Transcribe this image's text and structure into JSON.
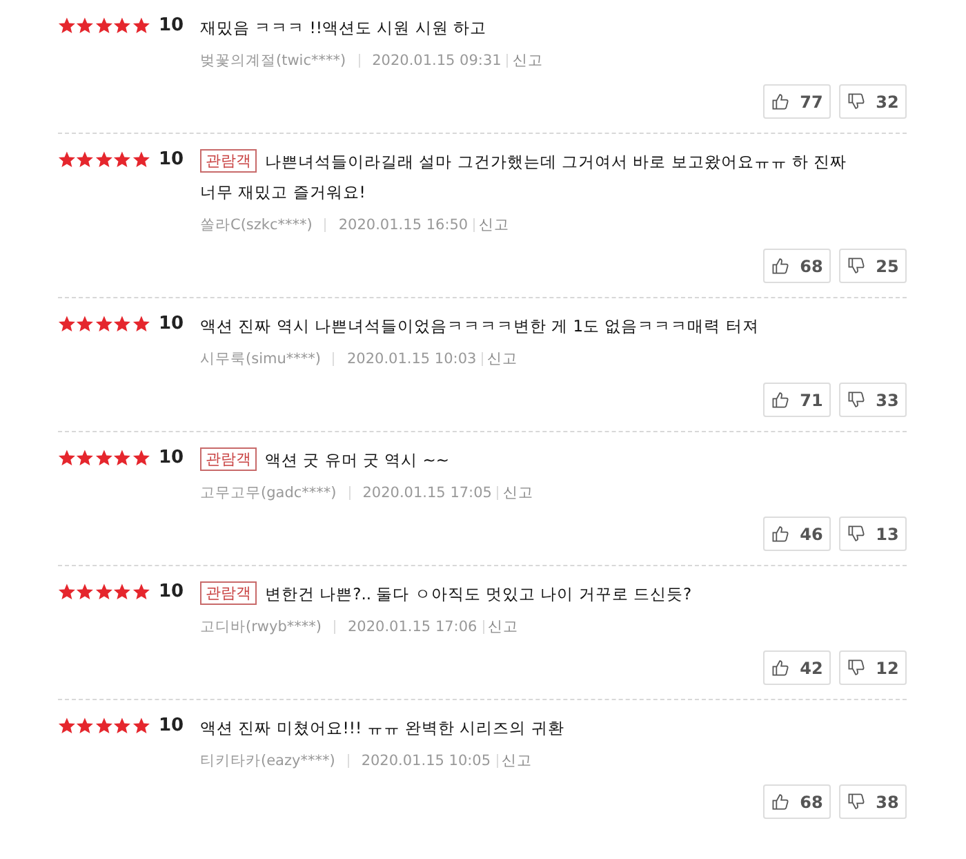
{
  "reviews": [
    {
      "stars": 5,
      "score": "10",
      "text": "재밌음 ㅋㅋㅋ !!액션도 시원 시원 하고",
      "author": "벚꽃의계절(twic****)",
      "date": "2020.01.15 09:31",
      "report": "신고",
      "likes": "77",
      "dislikes": "32"
    },
    {
      "stars": 5,
      "score": "10",
      "badge": "관람객",
      "text": "나쁜녀석들이라길래 설마 그건가했는데 그거여서 바로 보고왔어요ㅠㅠ 하 진짜 너무 재밌고 즐거워요!",
      "author": "쏠라C(szkc****)",
      "date": "2020.01.15 16:50",
      "report": "신고",
      "likes": "68",
      "dislikes": "25"
    },
    {
      "stars": 5,
      "score": "10",
      "text": "액션 진짜 역시 나쁜녀석들이었음ㅋㅋㅋㅋ변한 게 1도 없음ㅋㅋㅋ매력 터져",
      "author": "시무룩(simu****)",
      "date": "2020.01.15 10:03",
      "report": "신고",
      "likes": "71",
      "dislikes": "33"
    },
    {
      "stars": 5,
      "score": "10",
      "badge": "관람객",
      "text": "액션 굿 유머 굿 역시 ~~",
      "author": "고무고무(gadc****)",
      "date": "2020.01.15 17:05",
      "report": "신고",
      "likes": "46",
      "dislikes": "13"
    },
    {
      "stars": 5,
      "score": "10",
      "badge": "관람객",
      "text": "변한건 나쁜?.. 둘다 ㅇ아직도 멋있고 나이 거꾸로 드신듯?",
      "author": "고디바(rwyb****)",
      "date": "2020.01.15 17:06",
      "report": "신고",
      "likes": "42",
      "dislikes": "12"
    },
    {
      "stars": 5,
      "score": "10",
      "text": "액션 진짜 미쳤어요!!! ㅠㅠ 완벽한 시리즈의 귀환",
      "author": "티키타카(eazy****)",
      "date": "2020.01.15 10:05",
      "report": "신고",
      "likes": "68",
      "dislikes": "38"
    }
  ]
}
